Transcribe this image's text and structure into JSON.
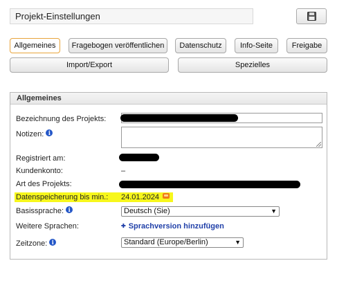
{
  "header": {
    "title": "Projekt-Einstellungen",
    "save_icon": "floppy-disk-icon"
  },
  "tabs": [
    {
      "label": "Allgemeines",
      "active": true
    },
    {
      "label": "Fragebogen veröffentlichen",
      "active": false
    },
    {
      "label": "Datenschutz",
      "active": false
    },
    {
      "label": "Info-Seite",
      "active": false
    },
    {
      "label": "Freigabe",
      "active": false
    },
    {
      "label": "Import/Export",
      "active": false
    },
    {
      "label": "Spezielles",
      "active": false
    }
  ],
  "panel": {
    "title": "Allgemeines",
    "fields": {
      "name_label": "Bezeichnung des Projekts:",
      "notes_label": "Notizen:",
      "registered_label": "Registriert am:",
      "account_label": "Kundenkonto:",
      "account_value": "–",
      "type_label": "Art des Projekts:",
      "retention_label": "Datenspeicherung bis min.:",
      "retention_value": "24.01.2024",
      "base_lang_label": "Basissprache:",
      "base_lang_value": "Deutsch (Sie)",
      "more_lang_label": "Weitere Sprachen:",
      "more_lang_link": "Sprachversion hinzufügen",
      "timezone_label": "Zeitzone:",
      "timezone_value": "Standard (Europe/Berlin)"
    },
    "info_icon_glyph": "i"
  },
  "colors": {
    "active_tab_border": "#e8a33a",
    "highlight": "#f7f71c",
    "link": "#1f3fa8",
    "info_icon": "#2457c8"
  }
}
